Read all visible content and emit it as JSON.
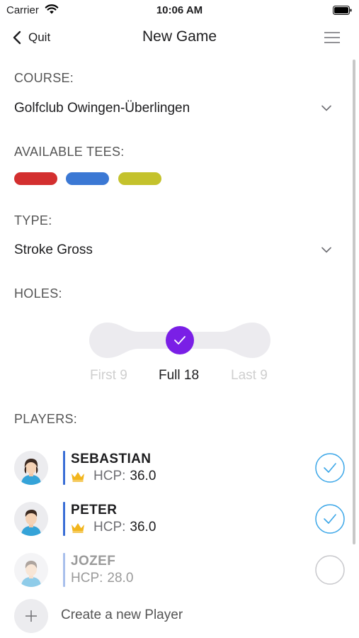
{
  "status_bar": {
    "carrier": "Carrier",
    "time": "10:06 AM"
  },
  "nav": {
    "back_label": "Quit",
    "title": "New Game"
  },
  "course": {
    "label": "COURSE:",
    "value": "Golfclub Owingen-Überlingen"
  },
  "tees": {
    "label": "AVAILABLE TEES:",
    "items": [
      {
        "color": "#d32f2f"
      },
      {
        "color": "#3b78d4"
      },
      {
        "color": "#c4c22c"
      }
    ]
  },
  "type": {
    "label": "TYPE:",
    "value": "Stroke Gross"
  },
  "holes": {
    "label": "HOLES:",
    "options": [
      "First 9",
      "Full 18",
      "Last 9"
    ],
    "selected": "Full 18"
  },
  "players": {
    "label": "PLAYERS:",
    "items": [
      {
        "name": "SEBASTIAN",
        "hcp_label": "HCP:",
        "hcp": "36.0",
        "selected": true
      },
      {
        "name": "PETER",
        "hcp_label": "HCP:",
        "hcp": "36.0",
        "selected": true
      },
      {
        "name": "JOZEF",
        "hcp_label": "HCP:",
        "hcp": "28.0",
        "selected": false
      }
    ]
  },
  "create_player": {
    "label": "Create a new Player"
  },
  "colors": {
    "accent_purple": "#7a1fe6",
    "check_blue": "#3aa6e8",
    "player_bar": "#3b6fd6",
    "crown_gold": "#f2b51c"
  }
}
